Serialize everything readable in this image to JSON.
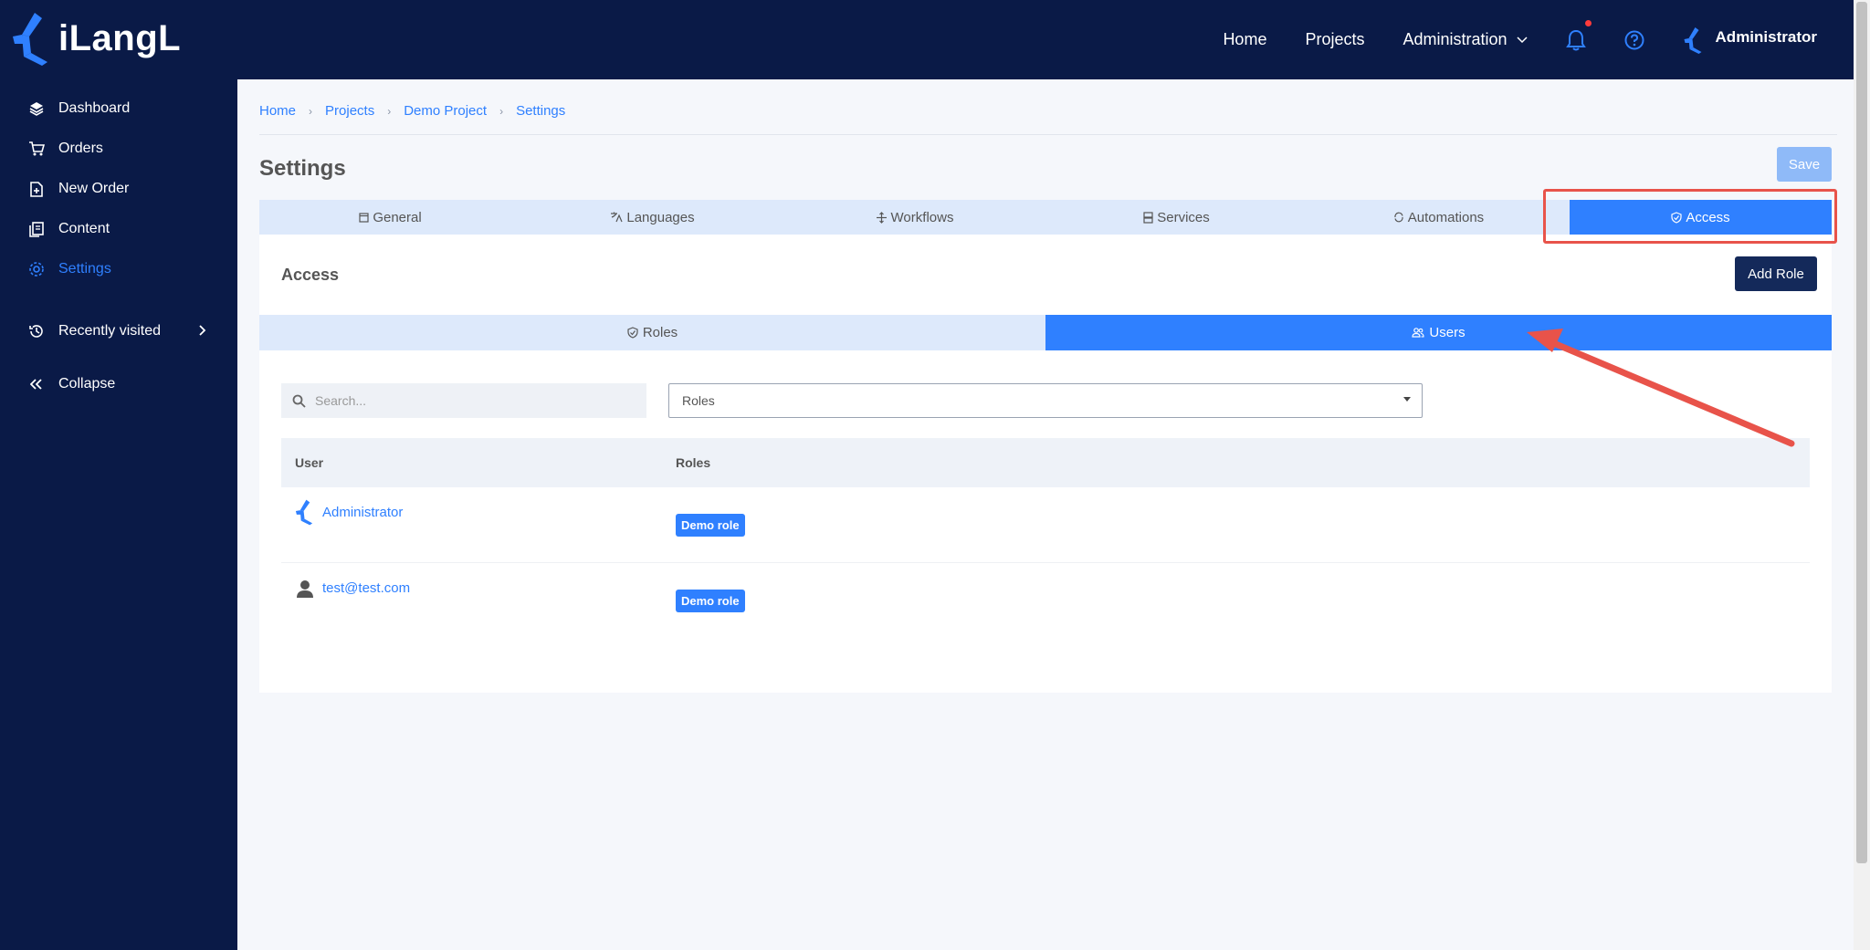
{
  "app": {
    "name": "iLangL"
  },
  "topnav": {
    "home": "Home",
    "projects": "Projects",
    "administration": "Administration",
    "user_name": "Administrator",
    "notification_icon": "bell-icon",
    "help_icon": "help-circle-icon"
  },
  "sidebar": {
    "items": [
      {
        "label": "Dashboard",
        "icon": "layers-icon"
      },
      {
        "label": "Orders",
        "icon": "cart-icon"
      },
      {
        "label": "New Order",
        "icon": "file-plus-icon"
      },
      {
        "label": "Content",
        "icon": "documents-icon"
      },
      {
        "label": "Settings",
        "icon": "gear-icon",
        "active": true
      }
    ],
    "recently_visited": "Recently visited",
    "collapse": "Collapse"
  },
  "breadcrumb": [
    "Home",
    "Projects",
    "Demo Project",
    "Settings"
  ],
  "page": {
    "title": "Settings",
    "save_label": "Save"
  },
  "tabs": [
    {
      "label": "General",
      "icon": "window-icon"
    },
    {
      "label": "Languages",
      "icon": "translate-icon"
    },
    {
      "label": "Workflows",
      "icon": "move-icon"
    },
    {
      "label": "Services",
      "icon": "server-icon"
    },
    {
      "label": "Automations",
      "icon": "refresh-icon"
    },
    {
      "label": "Access",
      "icon": "shield-check-icon",
      "active": true
    }
  ],
  "access": {
    "title": "Access",
    "add_role_label": "Add Role",
    "subtabs": [
      {
        "label": "Roles",
        "icon": "shield-check-icon"
      },
      {
        "label": "Users",
        "icon": "users-icon",
        "active": true
      }
    ],
    "search_placeholder": "Search...",
    "roles_filter": "Roles",
    "table": {
      "headers": [
        "User",
        "Roles"
      ],
      "rows": [
        {
          "user": "Administrator",
          "avatar": "ilangl-logo-icon",
          "role": "Demo role"
        },
        {
          "user": "test@test.com",
          "avatar": "person-icon",
          "role": "Demo role"
        }
      ]
    }
  },
  "colors": {
    "navy": "#0a1a47",
    "accent": "#2f80ff",
    "highlight": "#e8534a"
  }
}
